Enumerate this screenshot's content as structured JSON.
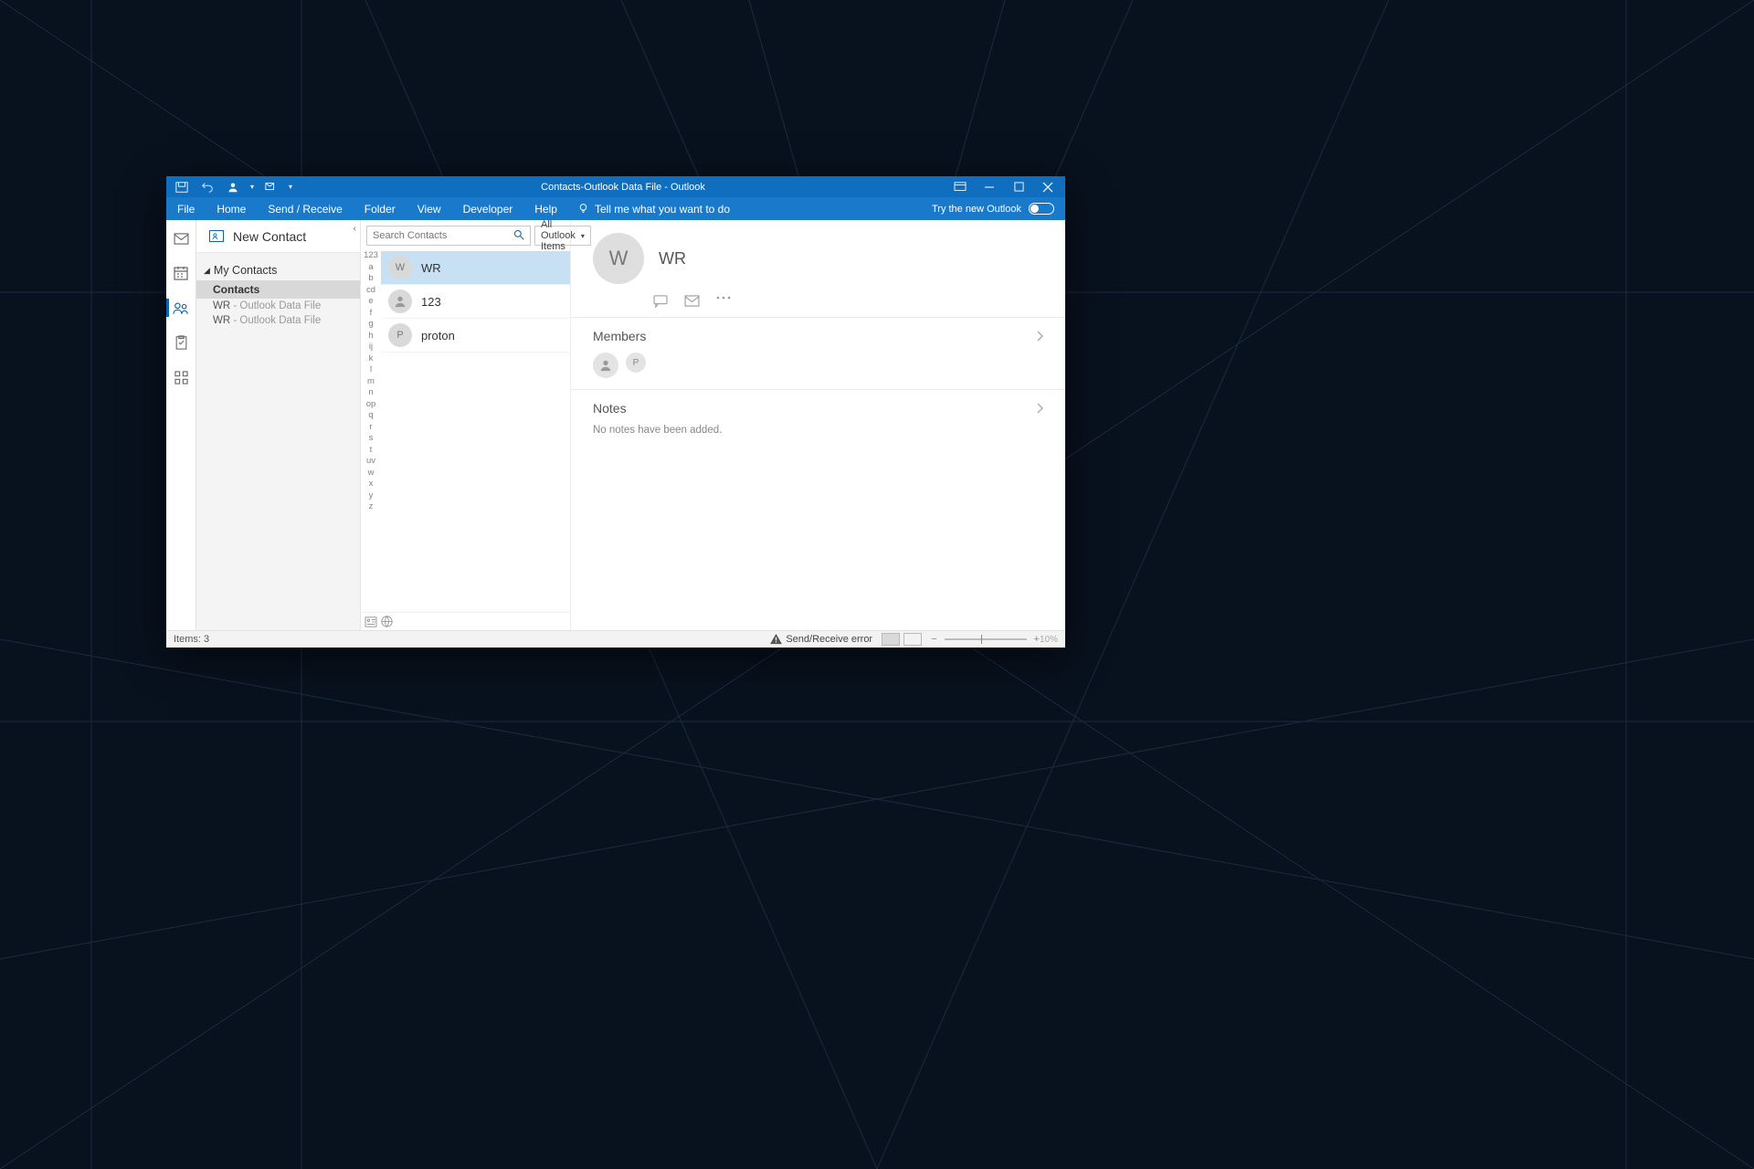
{
  "titlebar": {
    "title": "Contacts-Outlook Data File  -  Outlook"
  },
  "menu": {
    "items": [
      "File",
      "Home",
      "Send / Receive",
      "Folder",
      "View",
      "Developer",
      "Help"
    ],
    "tell_me": "Tell me what you want to do",
    "try_new": "Try the new Outlook"
  },
  "folderpane": {
    "new_contact": "New Contact",
    "group": "My Contacts",
    "items": [
      {
        "label": "Contacts",
        "selected": true
      },
      {
        "label": "WR",
        "suffix": "- Outlook Data File"
      },
      {
        "label": "WR",
        "suffix": "- Outlook Data File"
      }
    ]
  },
  "search": {
    "placeholder": "Search Contacts",
    "filter": "All Outlook Items"
  },
  "alpha": [
    "123",
    "a",
    "b",
    "cd",
    "e",
    "f",
    "g",
    "h",
    "ij",
    "k",
    "l",
    "m",
    "n",
    "op",
    "q",
    "r",
    "s",
    "t",
    "uv",
    "w",
    "x",
    "y",
    "z"
  ],
  "contacts": [
    {
      "initial": "W",
      "name": "WR",
      "selected": true
    },
    {
      "initial": "",
      "name": "123",
      "person_icon": true
    },
    {
      "initial": "P",
      "name": "proton"
    }
  ],
  "detail": {
    "initial": "W",
    "name": "WR",
    "members_label": "Members",
    "members": [
      {
        "person_icon": true
      },
      {
        "initial": "P"
      }
    ],
    "notes_label": "Notes",
    "notes_empty": "No notes have been added."
  },
  "status": {
    "items": "Items: 3",
    "error": "Send/Receive error",
    "zoom": "10%"
  }
}
